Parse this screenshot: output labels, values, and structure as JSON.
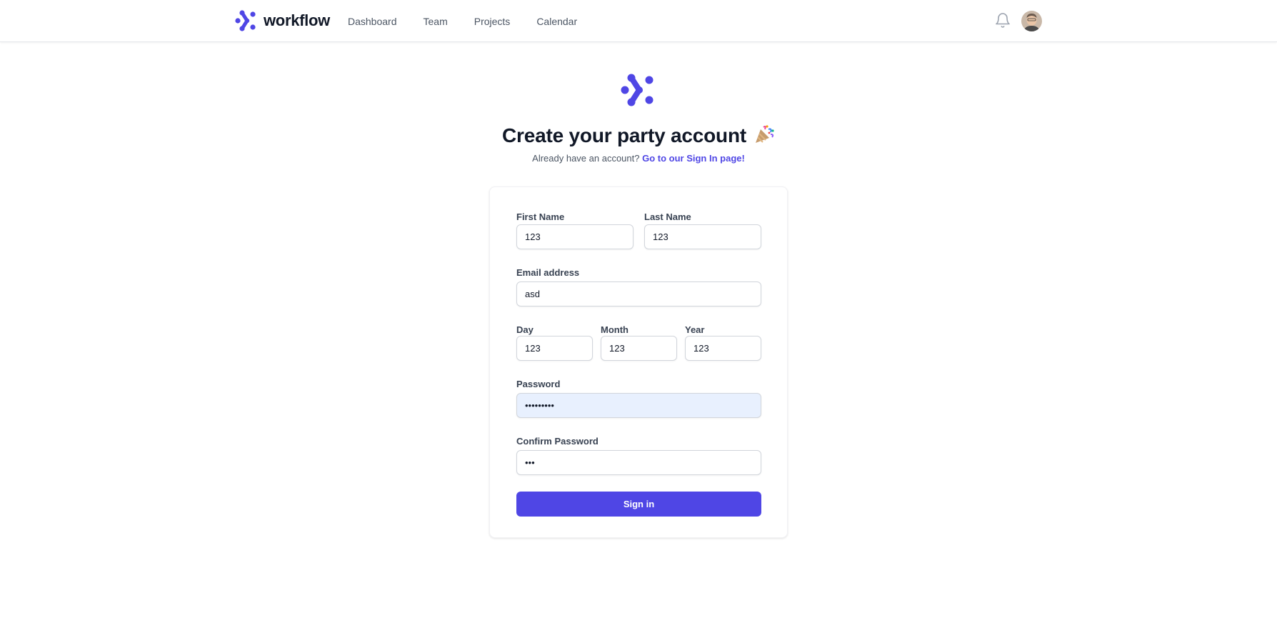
{
  "brand": {
    "name": "workflow",
    "logo_icon": "workflow-logo-icon",
    "accent": "#4f46e5"
  },
  "nav": {
    "items": [
      {
        "label": "Dashboard"
      },
      {
        "label": "Team"
      },
      {
        "label": "Projects"
      },
      {
        "label": "Calendar"
      }
    ]
  },
  "header_actions": {
    "notification_icon": "bell-icon",
    "avatar_icon": "user-avatar"
  },
  "page": {
    "title": "Create your party account",
    "title_icon": "party-popper-icon",
    "subtitle_text": "Already have an account?",
    "signin_link": "Go to our Sign In page!"
  },
  "form": {
    "first_name": {
      "label": "First Name",
      "value": "123"
    },
    "last_name": {
      "label": "Last Name",
      "value": "123"
    },
    "email": {
      "label": "Email address",
      "value": "asd"
    },
    "day": {
      "label": "Day",
      "value": "123"
    },
    "month": {
      "label": "Month",
      "value": "123"
    },
    "year": {
      "label": "Year",
      "value": "123"
    },
    "password": {
      "label": "Password",
      "value": "123456789"
    },
    "confirm_password": {
      "label": "Confirm Password",
      "value": "123"
    },
    "submit_label": "Sign in"
  },
  "colors": {
    "primary": "#4f46e5",
    "text": "#111827",
    "muted": "#4b5563",
    "autofill": "#e8f0fe"
  }
}
